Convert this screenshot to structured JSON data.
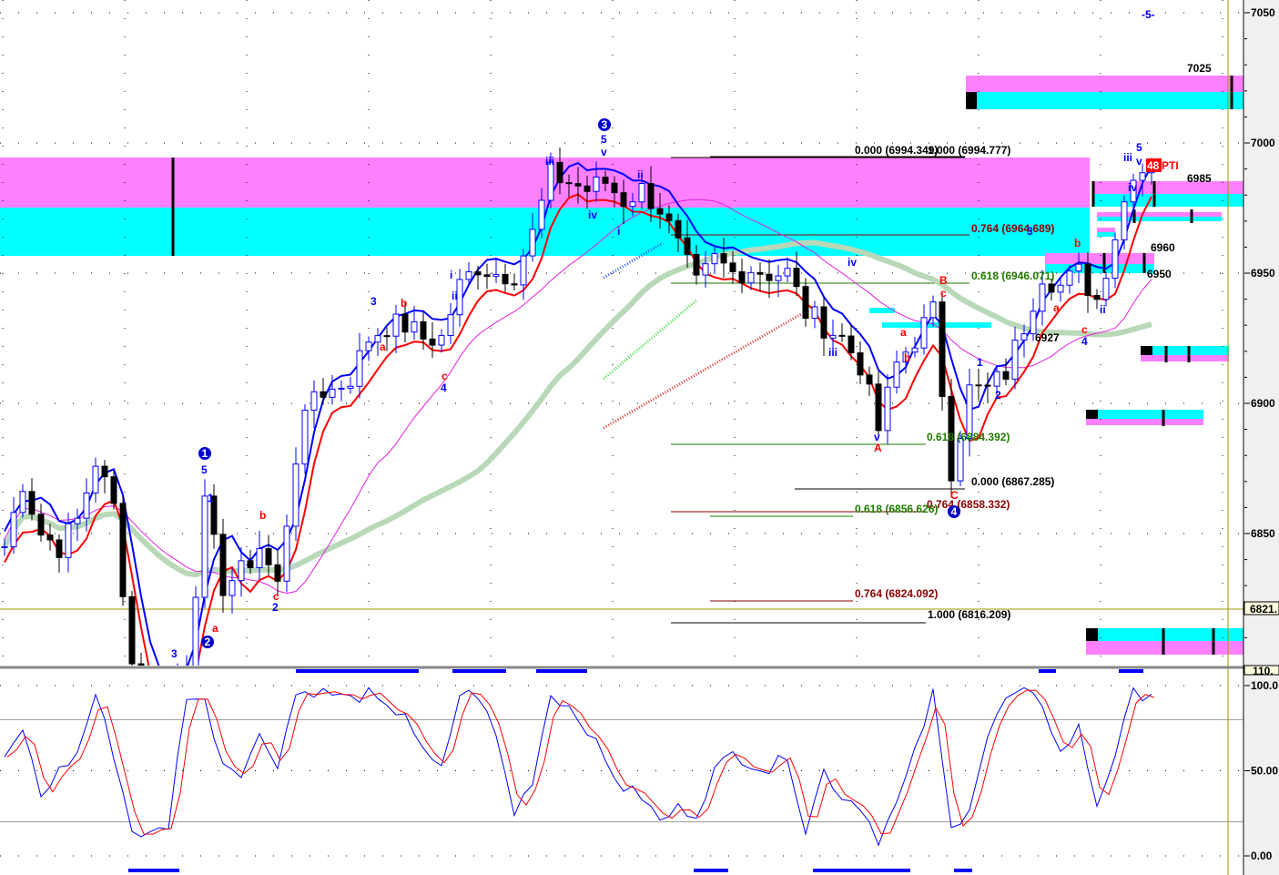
{
  "chart_data": {
    "type": "candlestick",
    "title": "",
    "price_axis": {
      "ticks": [
        "7050",
        "7000",
        "6950",
        "6900",
        "6850"
      ],
      "ylim": [
        6800,
        7055
      ],
      "current_price_badge": "6821."
    },
    "oscillator_axis": {
      "ticks": [
        "100.0",
        "50.00",
        "0.00"
      ],
      "top_badge": "110.",
      "ylim": [
        -3,
        110
      ],
      "guide_levels": [
        80,
        20
      ]
    },
    "closes": [
      6845,
      6870,
      6850,
      6845,
      6855,
      6878,
      6860,
      6800,
      6790,
      6790,
      6800,
      6860,
      6830,
      6835,
      6845,
      6830,
      6880,
      6905,
      6905,
      6910,
      6925,
      6930,
      6930,
      6925,
      6925,
      6945,
      6953,
      6950,
      6950,
      6965,
      6988,
      6985,
      6982,
      6985,
      6978,
      6982,
      6975,
      6960,
      6945,
      6955,
      6950,
      6952,
      6950,
      6950,
      6935,
      6930,
      6925,
      6915,
      6890,
      6915,
      6925,
      6935,
      6875,
      6905,
      6905,
      6912,
      6930,
      6950,
      6945,
      6950,
      6940,
      6965,
      6990,
      6990
    ],
    "stoch_k": [
      55,
      75,
      35,
      50,
      60,
      95,
      60,
      15,
      12,
      18,
      95,
      90,
      55,
      50,
      70,
      55,
      95,
      97,
      95,
      92,
      95,
      85,
      85,
      60,
      50,
      95,
      95,
      70,
      25,
      45,
      95,
      88,
      75,
      55,
      40,
      35,
      20,
      28,
      25,
      50,
      60,
      55,
      50,
      60,
      15,
      50,
      35,
      30,
      10,
      30,
      60,
      95,
      15,
      30,
      70,
      92,
      95,
      90,
      60,
      75,
      30,
      60,
      95,
      95
    ],
    "reference_level": 6821,
    "fib_labels": [
      {
        "text": "0.000 (6994.349)",
        "color": "#000000"
      },
      {
        "text": "1.000 (6994.777)",
        "color": "#000000"
      },
      {
        "text": "0.764 (6964.689)",
        "color": "#8b0000"
      },
      {
        "text": "0.618 (6946.071)",
        "color": "#1f7a00"
      },
      {
        "text": "0.618 (6884.392)",
        "color": "#1f7a00"
      },
      {
        "text": "0.000 (6867.285)",
        "color": "#000000"
      },
      {
        "text": "0.764 (6858.332)",
        "color": "#8b0000"
      },
      {
        "text": "0.618 (6856.626)",
        "color": "#1f7a00"
      },
      {
        "text": "0.764 (6824.092)",
        "color": "#8b0000"
      },
      {
        "text": "1.000 (6816.209)",
        "color": "#000000"
      }
    ],
    "price_targets": [
      "7025",
      "6985",
      "6960",
      "6950",
      "6927"
    ],
    "pti": {
      "value": "48",
      "label": "PTI"
    },
    "wave_labels": [
      "1",
      "5",
      "1",
      "2",
      "3",
      "a",
      "b",
      "c",
      "2",
      "3",
      "b",
      "a",
      "c",
      "4",
      "i",
      "ii",
      "iii",
      "iv",
      "3",
      "5",
      "v",
      "ii",
      "i",
      "iv",
      "iii",
      "v",
      "A",
      "a",
      "b",
      "B",
      "c",
      "C",
      "4",
      "1",
      "2",
      "3",
      "a",
      "b",
      "c",
      "4",
      "ii",
      "iii",
      "iv",
      "v",
      "5",
      "-5-"
    ],
    "colors": {
      "magenta": "#ff80ff",
      "cyan": "#00ffff",
      "blue": "#0000ff",
      "red": "#ff0000",
      "ma": "#b8d8b8"
    }
  }
}
